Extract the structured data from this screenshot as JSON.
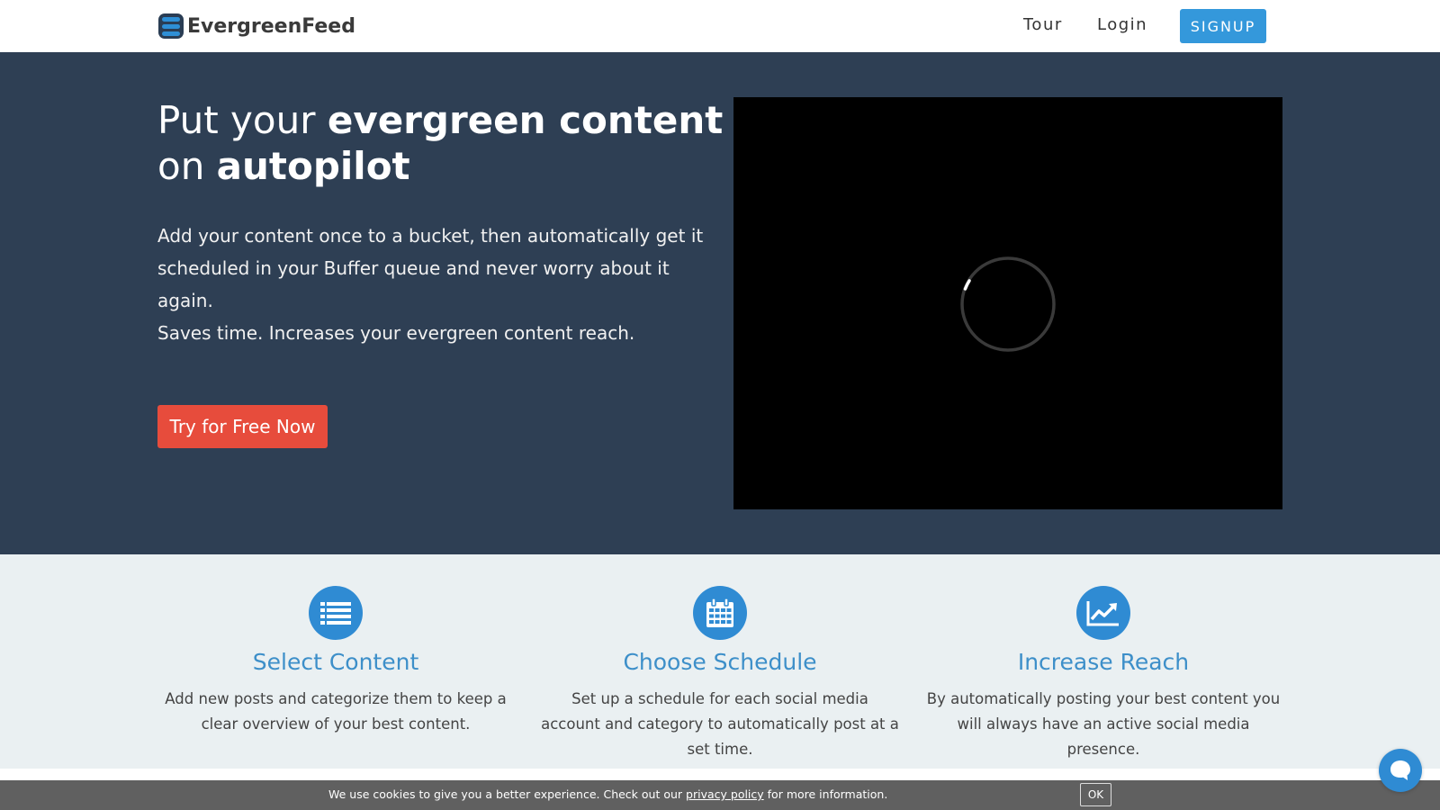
{
  "header": {
    "logo_text": "EvergreenFeed",
    "nav": {
      "tour": "Tour",
      "login": "Login",
      "signup": "SIGNUP"
    }
  },
  "hero": {
    "title_part1": "Put your ",
    "title_bold1": "evergreen content",
    "title_part2": " on ",
    "title_bold2": "autopilot",
    "paragraph1": "Add your content once to a bucket, then automatically get it scheduled in your Buffer queue and never worry about it again.",
    "paragraph2": "Saves time. Increases your evergreen content reach.",
    "cta_label": "Try for Free Now"
  },
  "features": [
    {
      "icon": "list-icon",
      "title": "Select Content",
      "description": "Add new posts and categorize them to keep a clear overview of your best content."
    },
    {
      "icon": "calendar-icon",
      "title": "Choose Schedule",
      "description": "Set up a schedule for each social media account and category to automatically post at a set time."
    },
    {
      "icon": "chart-up-icon",
      "title": "Increase Reach",
      "description": "By automatically posting your best content you will always have an active social media presence."
    }
  ],
  "cookie_bar": {
    "text_before": "We use cookies to give you a better experience. Check out our ",
    "link": "privacy policy",
    "text_after": " for more information.",
    "ok_label": "OK"
  },
  "colors": {
    "hero_bg": "#2e3f54",
    "accent_blue": "#3498db",
    "cta_red": "#e74c3c",
    "features_bg": "#eaf0f2",
    "feature_title": "#3d8fc9"
  }
}
